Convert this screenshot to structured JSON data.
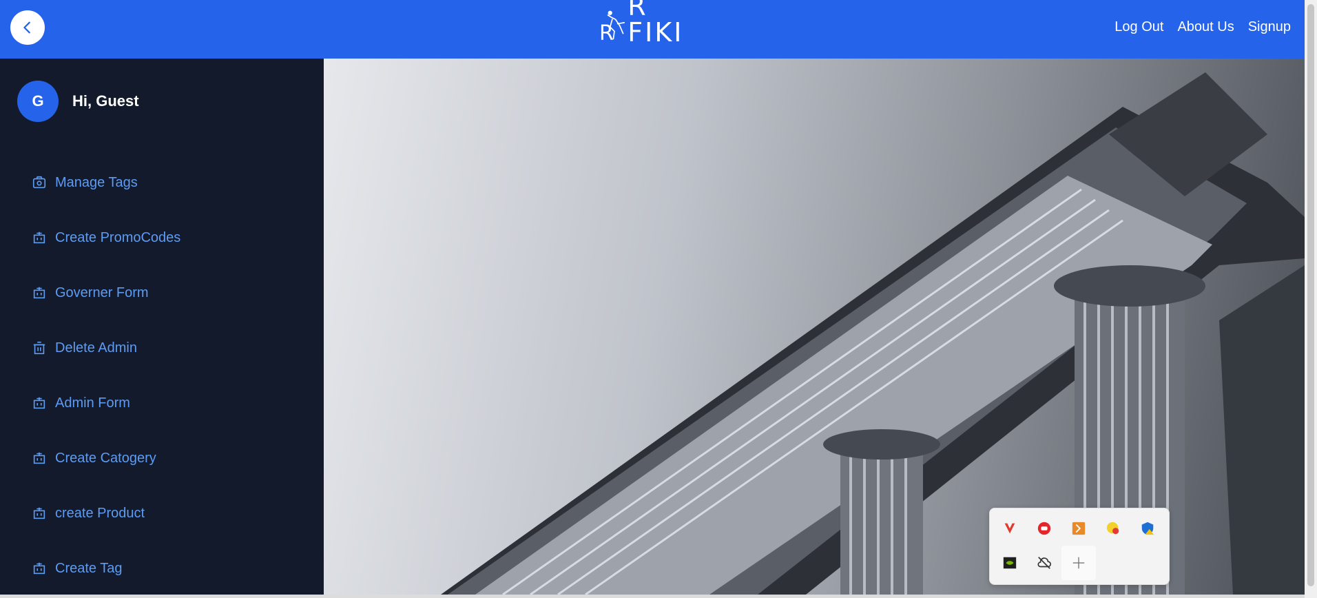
{
  "header": {
    "logo_text": "R FIKI",
    "nav": [
      "Log Out",
      "About Us",
      "Signup"
    ],
    "colors": {
      "primary": "#2563eb"
    }
  },
  "sidebar": {
    "avatar_initial": "G",
    "greeting": "Hi, Guest",
    "items": [
      {
        "label": "Manage Tags",
        "icon": "tag-icon"
      },
      {
        "label": "Create PromoCodes",
        "icon": "building-icon"
      },
      {
        "label": "Governer Form",
        "icon": "building-icon"
      },
      {
        "label": "Delete Admin",
        "icon": "trash-icon"
      },
      {
        "label": "Admin Form",
        "icon": "building-icon"
      },
      {
        "label": "Create Catogery",
        "icon": "building-icon"
      },
      {
        "label": "create Product",
        "icon": "building-icon"
      },
      {
        "label": "Create Tag",
        "icon": "building-icon"
      }
    ],
    "colors": {
      "bg": "#131a2c",
      "link": "#5d9cf2"
    }
  },
  "tray": {
    "icons": [
      "vivaldi-icon",
      "red-app-icon",
      "orange-app-icon",
      "yellow-app-icon",
      "shield-warning-icon",
      "nvidia-icon",
      "cloud-off-icon",
      "add-icon"
    ]
  }
}
